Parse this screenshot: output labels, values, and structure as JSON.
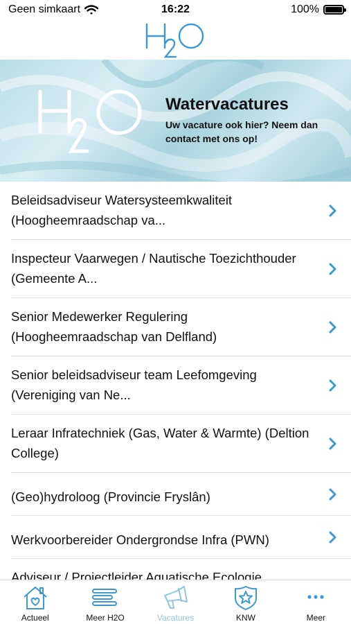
{
  "status_bar": {
    "carrier": "Geen simkaart",
    "time": "16:22",
    "battery": "100%",
    "battery_level": 1.0,
    "icons": [
      "wifi-icon",
      "battery-icon"
    ]
  },
  "header": {
    "logo_text": "H2O",
    "logo_color": "#3a9ad4"
  },
  "banner": {
    "title": "Watervacatures",
    "subtitle": "Uw vacature ook hier? Neem dan contact met ons op!",
    "logo_text": "H2O"
  },
  "vacancies": [
    {
      "title": "Beleidsadviseur Watersysteemkwaliteit (Hoogheemraadschap va..."
    },
    {
      "title": "Inspecteur Vaarwegen / Nautische Toezichthouder (Gemeente A..."
    },
    {
      "title": "Senior Medewerker Regulering (Hoogheemraadschap van Delfland)"
    },
    {
      "title": "Senior beleidsadviseur team Leefomgeving (Vereniging van Ne..."
    },
    {
      "title": "Leraar Infratechniek (Gas, Water & Warmte) (Deltion College)"
    },
    {
      "title": "(Geo)hydroloog (Provincie Fryslân)"
    },
    {
      "title": "Werkvoorbereider Ondergrondse Infra (PWN)"
    },
    {
      "title": "Adviseur / Projectleider Aquatische Ecologie"
    }
  ],
  "tab_bar": {
    "tabs": [
      {
        "label": "Actueel",
        "icon": "house-icon",
        "active": false
      },
      {
        "label": "Meer H2O",
        "icon": "lines-icon",
        "active": false
      },
      {
        "label": "Vacatures",
        "icon": "megaphone-icon",
        "active": true
      },
      {
        "label": "KNW",
        "icon": "star-badge-icon",
        "active": false
      },
      {
        "label": "Meer",
        "icon": "more-dots-icon",
        "active": false
      }
    ],
    "accent_color": "#3a9ad4",
    "inactive_label_color": "#111111",
    "active_color": "#8fc6e0"
  }
}
